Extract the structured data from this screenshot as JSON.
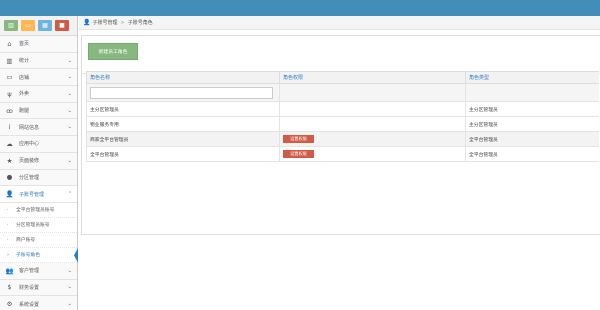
{
  "shortcuts": [
    {
      "icon": "bar-chart-icon",
      "glyph": "▥",
      "color": "#87b87f"
    },
    {
      "icon": "monitor-icon",
      "glyph": "▭",
      "color": "#ffb752"
    },
    {
      "icon": "building-icon",
      "glyph": "▦",
      "color": "#6fb3e0"
    },
    {
      "icon": "briefcase-icon",
      "glyph": "■",
      "color": "#d15b47"
    }
  ],
  "sidebar": {
    "items": [
      {
        "label": "首页",
        "icon": "home-icon",
        "glyph": "⌂",
        "has_children": false
      },
      {
        "label": "统计",
        "icon": "bar-chart-icon",
        "glyph": "▥",
        "has_children": true
      },
      {
        "label": "店铺",
        "icon": "desktop-icon",
        "glyph": "▭",
        "has_children": true
      },
      {
        "label": "外卖",
        "icon": "cutlery-icon",
        "glyph": "ψ",
        "has_children": true
      },
      {
        "label": "跑腿",
        "icon": "bicycle-icon",
        "glyph": "ꝏ",
        "has_children": true
      },
      {
        "label": "网站信息",
        "icon": "info-icon",
        "glyph": "i",
        "has_children": true
      },
      {
        "label": "应用中心",
        "icon": "cloud-icon",
        "glyph": "☁",
        "has_children": false
      },
      {
        "label": "页面装修",
        "icon": "star-icon",
        "glyph": "★",
        "has_children": true
      },
      {
        "label": "分区管理",
        "icon": "circle-icon",
        "glyph": "●",
        "has_children": false
      }
    ],
    "open_item": {
      "label": "子账号管理",
      "icon": "user-icon",
      "glyph": "👤"
    },
    "sub_items": [
      {
        "label": "全平台管理员账号"
      },
      {
        "label": "分区管理员账号"
      },
      {
        "label": "商户账号"
      },
      {
        "label": "子账号角色"
      }
    ],
    "bottom_items": [
      {
        "label": "客户管理",
        "icon": "users-icon",
        "glyph": "👥",
        "has_children": true
      },
      {
        "label": "财务设置",
        "icon": "dollar-icon",
        "glyph": "$",
        "has_children": true
      },
      {
        "label": "系统设置",
        "icon": "cog-icon",
        "glyph": "⚙",
        "has_children": true
      }
    ]
  },
  "breadcrumb": {
    "home": "子账号管理",
    "current": "子账号角色"
  },
  "toolbar": {
    "new_button": "新建员工角色"
  },
  "table": {
    "headers": [
      "角色名称",
      "角色权限",
      "角色类型"
    ],
    "rows": [
      {
        "name": "主分区管理员",
        "permission": "",
        "type": "主分区管理员"
      },
      {
        "name": "物业服务专用",
        "permission": "",
        "type": "主分区管理员"
      },
      {
        "name": "商家全平台管理员",
        "permission": "设置权限",
        "type": "全平台管理员"
      },
      {
        "name": "全平台管理员",
        "permission": "设置权限",
        "type": "全平台管理员"
      }
    ]
  },
  "colors": {
    "accent": "#438eb9",
    "link": "#307ecc",
    "success": "#87b87f",
    "danger": "#d15b47"
  }
}
